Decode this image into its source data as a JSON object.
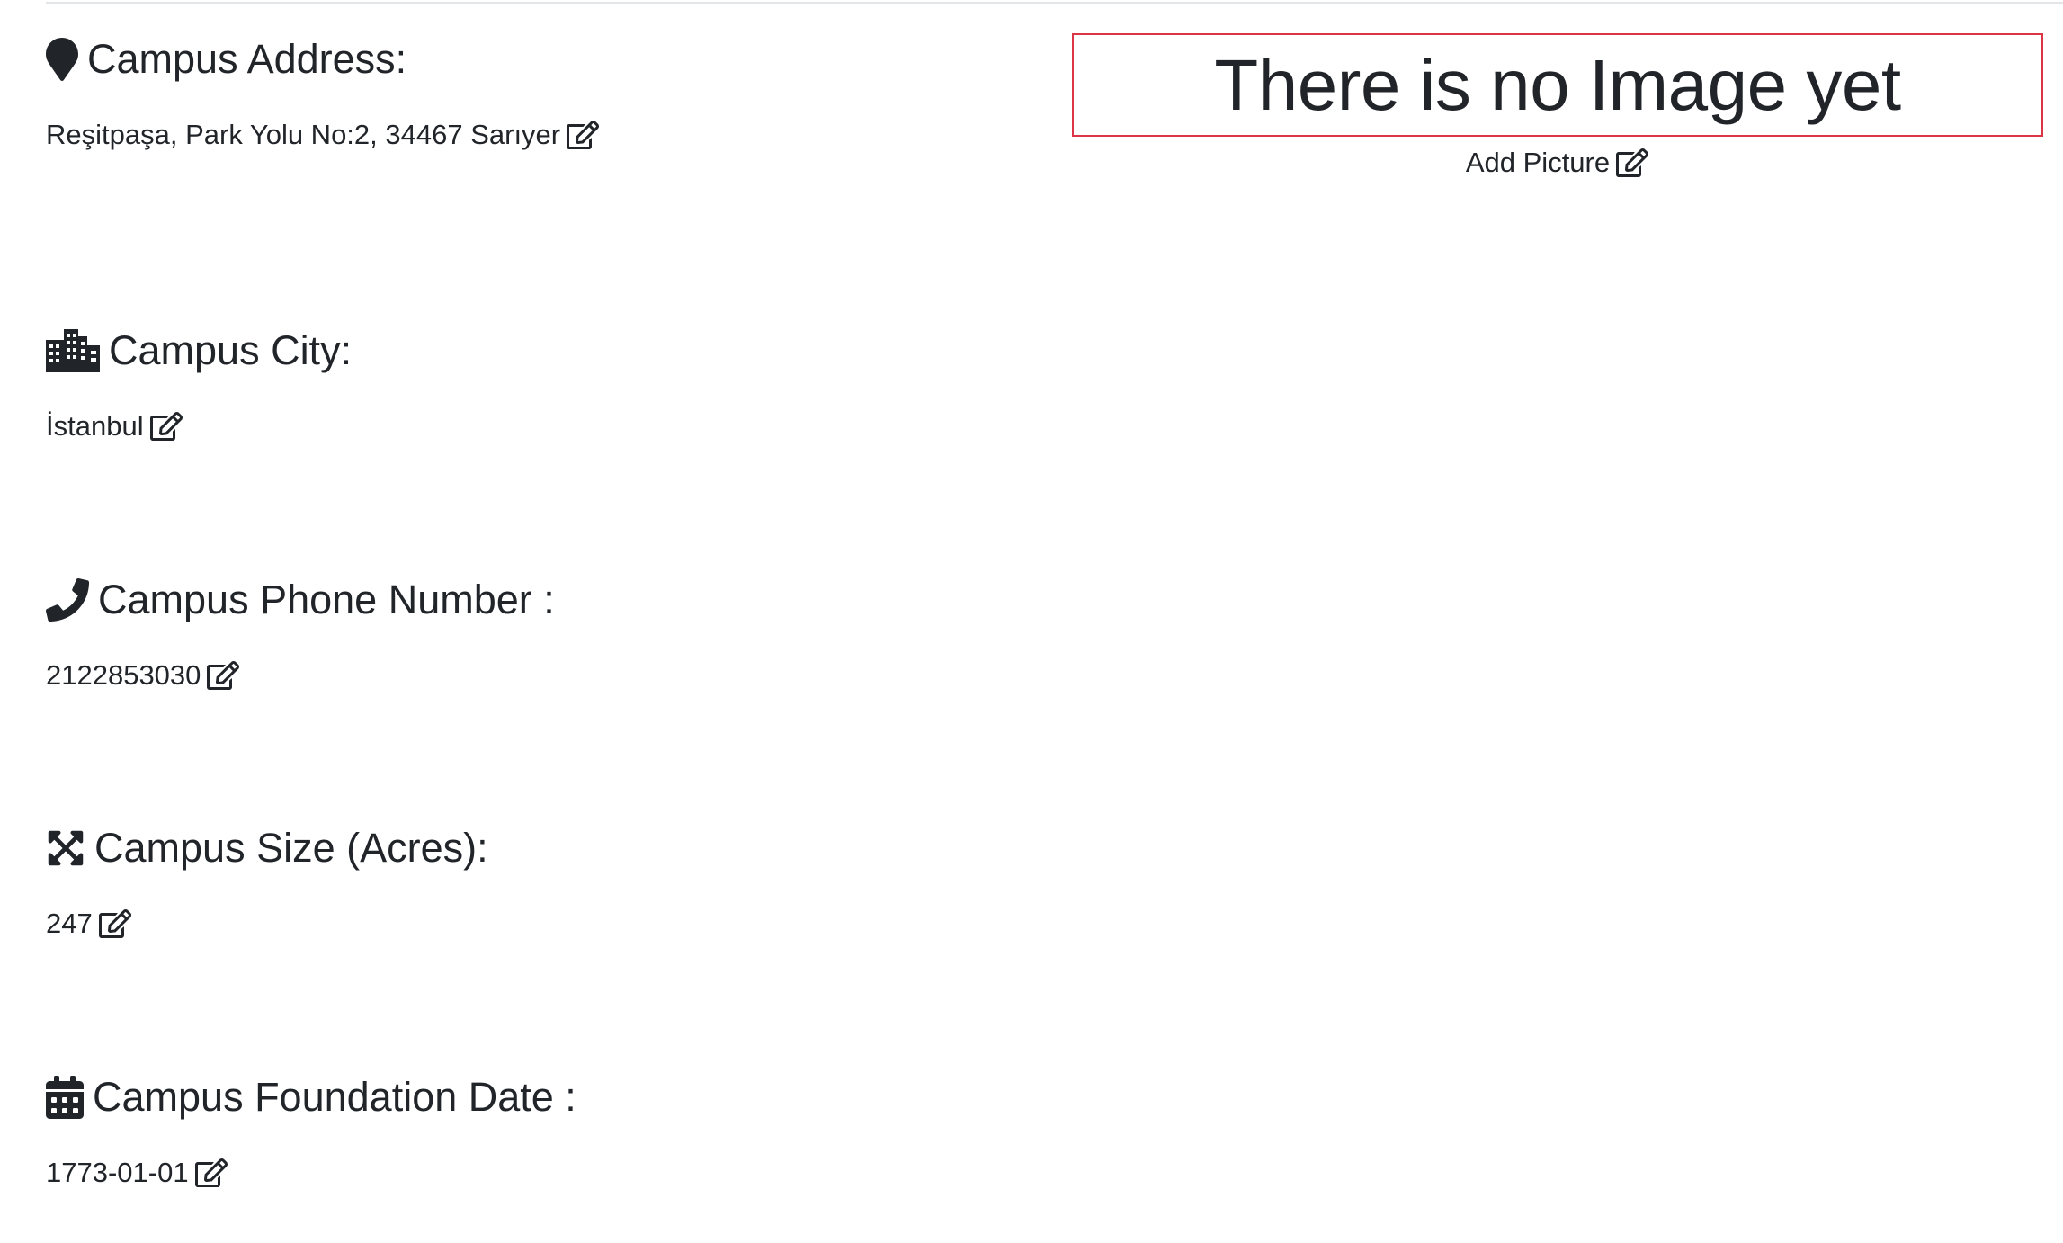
{
  "campus": {
    "address": {
      "heading": "Campus Address:",
      "value": "Reşitpaşa, Park Yolu No:2, 34467 Sarıyer",
      "icon": "map-marker-icon"
    },
    "city": {
      "heading": "Campus City:",
      "value": "İstanbul",
      "icon": "city-icon"
    },
    "phone": {
      "heading": "Campus Phone Number :",
      "value": "2122853030",
      "icon": "phone-icon"
    },
    "size": {
      "heading": "Campus Size (Acres):",
      "value": "247",
      "icon": "expand-arrows-icon"
    },
    "foundation_date": {
      "heading": "Campus Foundation Date :",
      "value": "1773-01-01",
      "icon": "calendar-icon"
    }
  },
  "image_panel": {
    "placeholder_text": "There is no Image yet",
    "add_picture_label": "Add Picture",
    "border_color": "#dc3545"
  },
  "edit_icon": "edit-icon",
  "colors": {
    "text": "#212529",
    "divider": "#e3e6e9"
  }
}
